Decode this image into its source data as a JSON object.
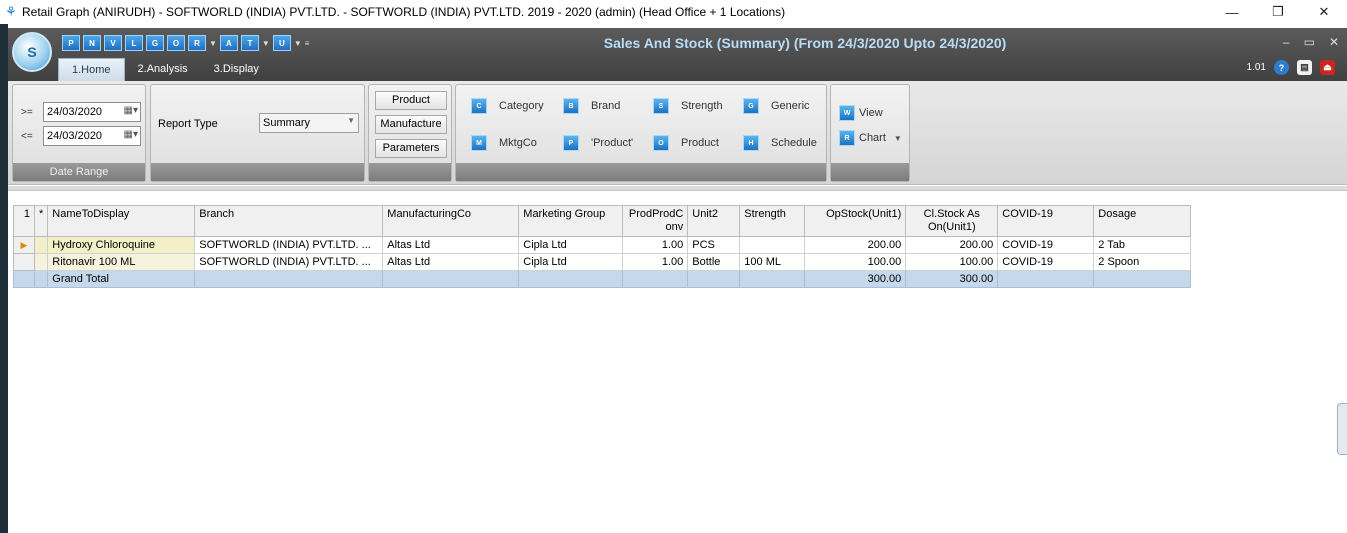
{
  "window": {
    "title": "Retail Graph (ANIRUDH) - SOFTWORLD (INDIA) PVT.LTD. - SOFTWORLD (INDIA) PVT.LTD.  2019 - 2020 (admin) (Head Office + 1 Locations)",
    "minimize": "—",
    "maximize": "❐",
    "close": "✕"
  },
  "app": {
    "logo_text": "S",
    "title": "Sales And Stock (Summary)  (From 24/3/2020 Upto 24/3/2020)",
    "version": "1.01",
    "quick_access": [
      "P",
      "N",
      "V",
      "L",
      "G",
      "O",
      "R",
      "A",
      "T",
      "U"
    ],
    "controls": [
      "–",
      "▭",
      "✕"
    ]
  },
  "tabs": [
    "1.Home",
    "2.Analysis",
    "3.Display"
  ],
  "ribbon": {
    "date_range": {
      "from_label": ">=",
      "from_value": "24/03/2020",
      "to_label": "<=",
      "to_value": "24/03/2020",
      "caption": "Date Range"
    },
    "report_type": {
      "label": "Report Type",
      "value": "Summary"
    },
    "buttons": [
      "Product",
      "Manufacture",
      "Parameters"
    ],
    "filters": [
      {
        "label": "Category",
        "icon": "category-icon",
        "glyph": "C"
      },
      {
        "label": "Brand",
        "icon": "brand-icon",
        "glyph": "B"
      },
      {
        "label": "Strength",
        "icon": "strength-icon",
        "glyph": "S"
      },
      {
        "label": "Generic",
        "icon": "generic-icon",
        "glyph": "G"
      },
      {
        "label": "MktgCo",
        "icon": "mktgco-icon",
        "glyph": "M"
      },
      {
        "label": "'Product'",
        "icon": "product-quoted-icon",
        "glyph": "P"
      },
      {
        "label": "Product",
        "icon": "product-icon",
        "glyph": "O"
      },
      {
        "label": "Schedule",
        "icon": "schedule-icon",
        "glyph": "H"
      }
    ],
    "view_label": "View",
    "chart_label": "Chart"
  },
  "grid": {
    "columns": [
      "1",
      "*",
      "NameToDisplay",
      "Branch",
      "ManufacturingCo",
      "Marketing Group",
      "ProdProdConv",
      "Unit2",
      "Strength",
      "OpStock(Unit1)",
      "Cl.Stock As On(Unit1)",
      "COVID-19",
      "Dosage"
    ],
    "rows": [
      {
        "name": "Hydroxy Chloroquine",
        "branch": "SOFTWORLD (INDIA) PVT.LTD.   ...",
        "mfg": "Altas Ltd",
        "mkt": "Cipla Ltd",
        "conv": "1.00",
        "unit2": "PCS",
        "strength": "",
        "opstock": "200.00",
        "clstock": "200.00",
        "covid": "COVID-19",
        "dosage": "2 Tab"
      },
      {
        "name": "Ritonavir 100 ML",
        "branch": "SOFTWORLD (INDIA) PVT.LTD.   ...",
        "mfg": "Altas Ltd",
        "mkt": "Cipla Ltd",
        "conv": "1.00",
        "unit2": "Bottle",
        "strength": "100 ML",
        "opstock": "100.00",
        "clstock": "100.00",
        "covid": "COVID-19",
        "dosage": "2 Spoon"
      }
    ],
    "total": {
      "label": "Grand Total",
      "opstock": "300.00",
      "clstock": "300.00"
    }
  }
}
